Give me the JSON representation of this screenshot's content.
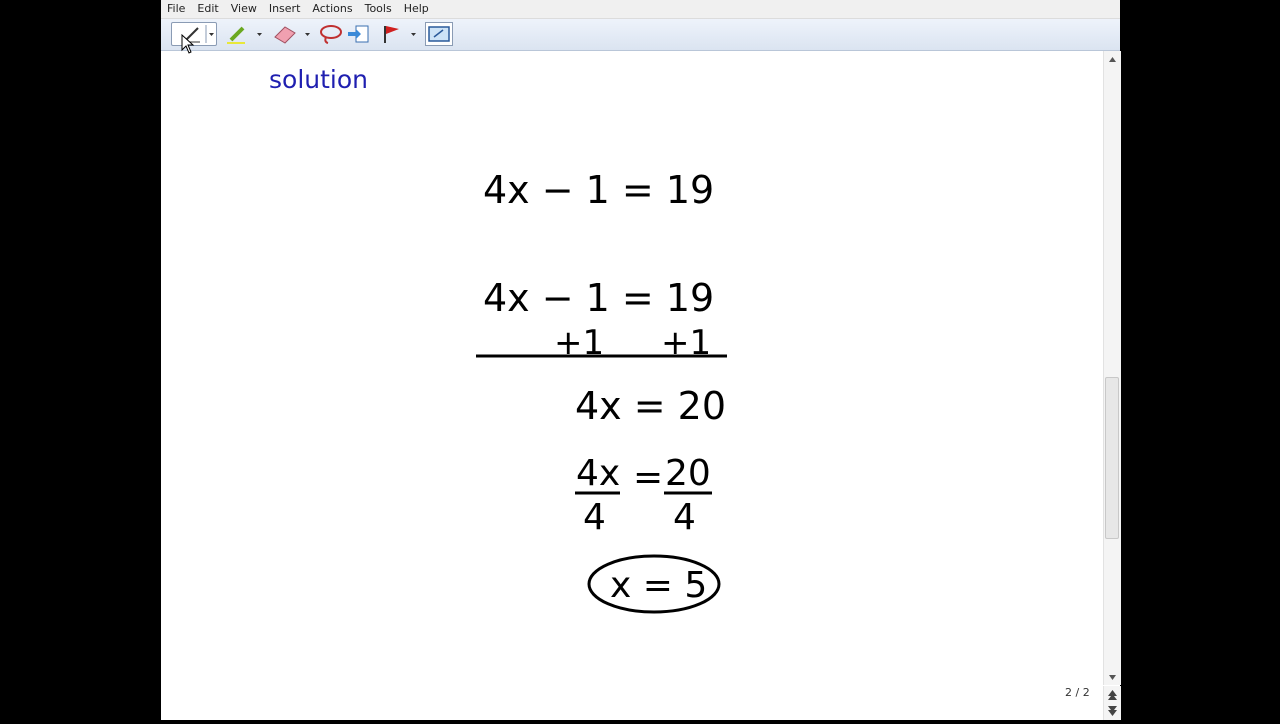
{
  "menu": [
    "File",
    "Edit",
    "View",
    "Insert",
    "Actions",
    "Tools",
    "Help"
  ],
  "toolbar": {
    "pen": "pen-tool-icon",
    "highlighter": "highlighter-icon",
    "eraser": "eraser-icon",
    "lasso": "lasso-icon",
    "insert_space": "insert-space-icon",
    "flag": "flag-icon",
    "screen": "screen-capture-icon"
  },
  "page": {
    "heading": "solution",
    "lines": [
      "4x − 1 = 19",
      "4x − 1 = 19",
      "+1",
      "+1",
      "4x = 20",
      "4x",
      "4",
      "=",
      "20",
      "4",
      "x = 5"
    ],
    "page_indicator": "2 / 2"
  },
  "colors": {
    "heading": "#1f1fb0",
    "ink": "#000000",
    "toolbar_bg": "#e4ebf6"
  }
}
